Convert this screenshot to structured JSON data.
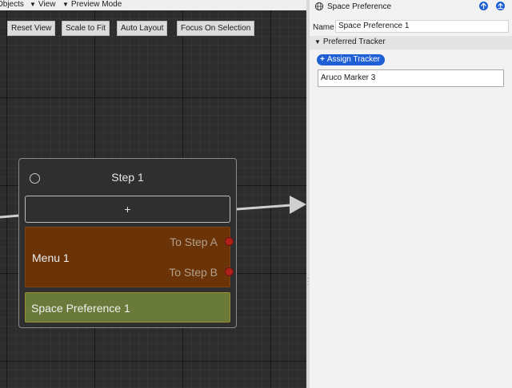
{
  "menubar": {
    "items": [
      "Objects",
      "View",
      "Preview Mode"
    ]
  },
  "toolbar": {
    "reset_view": "Reset View",
    "scale_to_fit": "Scale to Fit",
    "auto_layout": "Auto Layout",
    "focus_on_selection": "Focus On Selection"
  },
  "step_node": {
    "title": "Step 1",
    "add_label": "+",
    "menu": {
      "title": "Menu 1",
      "outputs": [
        "To Step A",
        "To Step B"
      ],
      "port_color": "#b2201e"
    },
    "space_preference": {
      "title": "Space Preference 1"
    }
  },
  "inspector": {
    "title": "Space Preference",
    "header_icon": "globe-icon",
    "name_label": "Name",
    "name_value": "Space Preference 1",
    "section_title": "Preferred Tracker",
    "assign_button": "Assign Tracker",
    "tracker_value": "Aruco Marker 3",
    "accent_color": "#1f5fd6"
  }
}
